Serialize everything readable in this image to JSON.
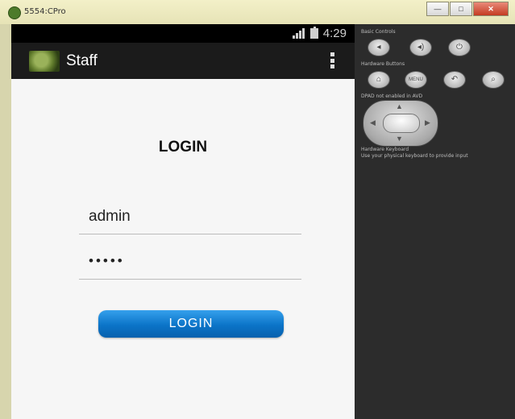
{
  "window": {
    "title": "5554:CPro",
    "buttons": {
      "minimize": "—",
      "maximize": "□",
      "close": "✕"
    }
  },
  "device": {
    "status_time": "4:29",
    "app_title": "Staff"
  },
  "form": {
    "heading": "LOGIN",
    "username_value": "admin",
    "password_value": "•••••",
    "button_label": "LOGIN"
  },
  "controls": {
    "basic_label": "Basic Controls",
    "basic_buttons": [
      "volume-down-icon",
      "volume-up-icon",
      "power-icon"
    ],
    "hardware_label": "Hardware Buttons",
    "hardware_buttons": [
      "home-icon",
      "menu-button",
      "back-icon",
      "search-icon"
    ],
    "menu_text": "MENU",
    "dpad_label": "DPAD not enabled in AVD",
    "keyboard_label": "Hardware Keyboard",
    "keyboard_hint": "Use your physical keyboard to provide input"
  }
}
